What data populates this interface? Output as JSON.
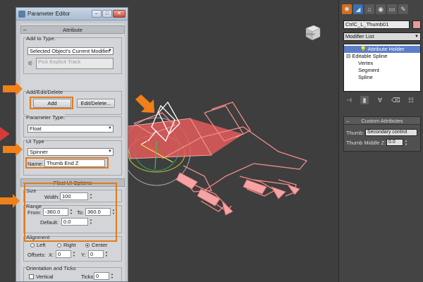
{
  "dialog": {
    "title": "Parameter Editor",
    "attribute_rollout": "Attribute",
    "add_to_type_label": "Add to Type:",
    "add_to_type_value": "Selected Object's Current Modifier",
    "pick_explicit_track_placeholder": "Pick Explicit Track",
    "add_edit_delete_label": "Add/Edit/Delete",
    "add_button": "Add",
    "edit_delete_button": "Edit/Delete...",
    "parameter_type_label": "Parameter Type:",
    "parameter_type_value": "Float",
    "ui_type_label": "UI Type",
    "ui_type_value": "Spinner",
    "name_label": "Name:",
    "name_value": "Thumb End Z",
    "float_ui_rollout": "Float UI Options",
    "size_label": "Size",
    "width_label": "Width:",
    "width_value": "100",
    "range_label": "Range",
    "from_label": "From:",
    "from_value": "-360.0",
    "to_label": "To:",
    "to_value": "360.0",
    "default_label": "Default:",
    "default_value": "0.0",
    "alignment_label": "Alignment",
    "align_left": "Left",
    "align_right": "Right",
    "align_center": "Center",
    "align_selected": "Center",
    "offsets_label": "Offsets:",
    "offset_x_label": "X:",
    "offset_x_value": "0",
    "offset_y_label": "Y:",
    "offset_y_value": "0",
    "orientation_label": "Orientation and Ticks",
    "vertical_label": "Vertical",
    "vertical_checked": false,
    "ticks_label": "Ticks:",
    "ticks_value": "0"
  },
  "viewcube_label": "FRONT",
  "command_panel": {
    "tab_icons": [
      "create-icon",
      "modify-icon",
      "hierarchy-icon",
      "motion-icon",
      "display-icon",
      "utilities-icon"
    ],
    "object_name": "CtrlC_L_Thumb01",
    "object_color": "#e99a9a",
    "modifier_list": "Modifier List",
    "stack": [
      {
        "label": "Attribute Holder",
        "selected": true,
        "indent": 0
      },
      {
        "label": "Editable Spline",
        "selected": false,
        "indent": 0
      },
      {
        "label": "Vertex",
        "selected": false,
        "indent": 1
      },
      {
        "label": "Segment",
        "selected": false,
        "indent": 1
      },
      {
        "label": "Spline",
        "selected": false,
        "indent": 1
      }
    ],
    "custom_attributes_title": "Custom Attributes",
    "thumb_label": "Thumb:",
    "thumb_value": "Secondary control",
    "thumb_middle_z_label": "Thumb Middle Z:",
    "thumb_middle_z_value": "0.0"
  },
  "colors": {
    "highlight": "#e07b1f",
    "spline": "#f08a8a",
    "stack_selection": "#5b7ec9"
  }
}
